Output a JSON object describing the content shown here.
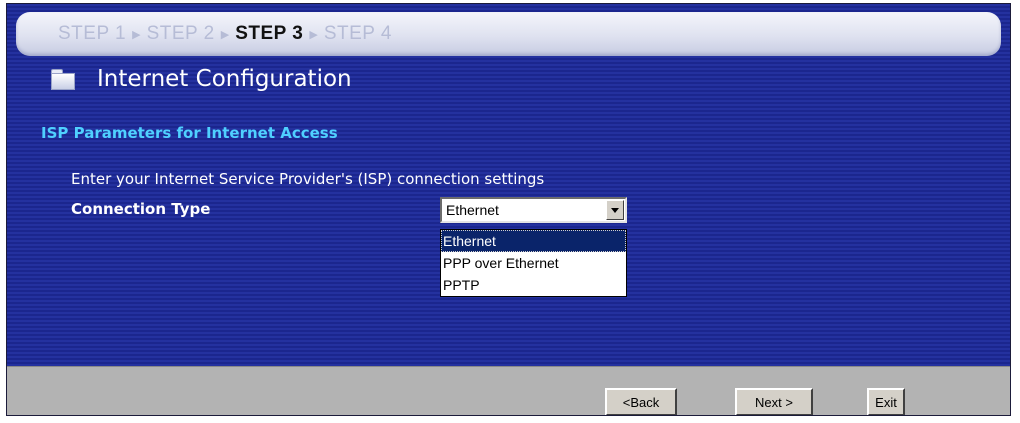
{
  "steps": [
    {
      "label": "STEP 1",
      "active": false
    },
    {
      "label": "STEP 2",
      "active": false
    },
    {
      "label": "STEP 3",
      "active": true
    },
    {
      "label": "STEP 4",
      "active": false
    }
  ],
  "header": {
    "title": "Internet Configuration",
    "icon": "folder-icon"
  },
  "section": {
    "title": "ISP Parameters for Internet Access",
    "intro": "Enter your Internet Service Provider's (ISP) connection settings"
  },
  "connection_type": {
    "label": "Connection Type",
    "selected": "Ethernet",
    "options": [
      "Ethernet",
      "PPP over Ethernet",
      "PPTP"
    ]
  },
  "buttons": {
    "back": "<Back",
    "next": "Next >",
    "exit": "Exit"
  },
  "colors": {
    "background": "#1e2a9a",
    "section_title": "#4fd0ff",
    "footer": "#b3b3b3",
    "option_highlight": "#0a246a"
  }
}
